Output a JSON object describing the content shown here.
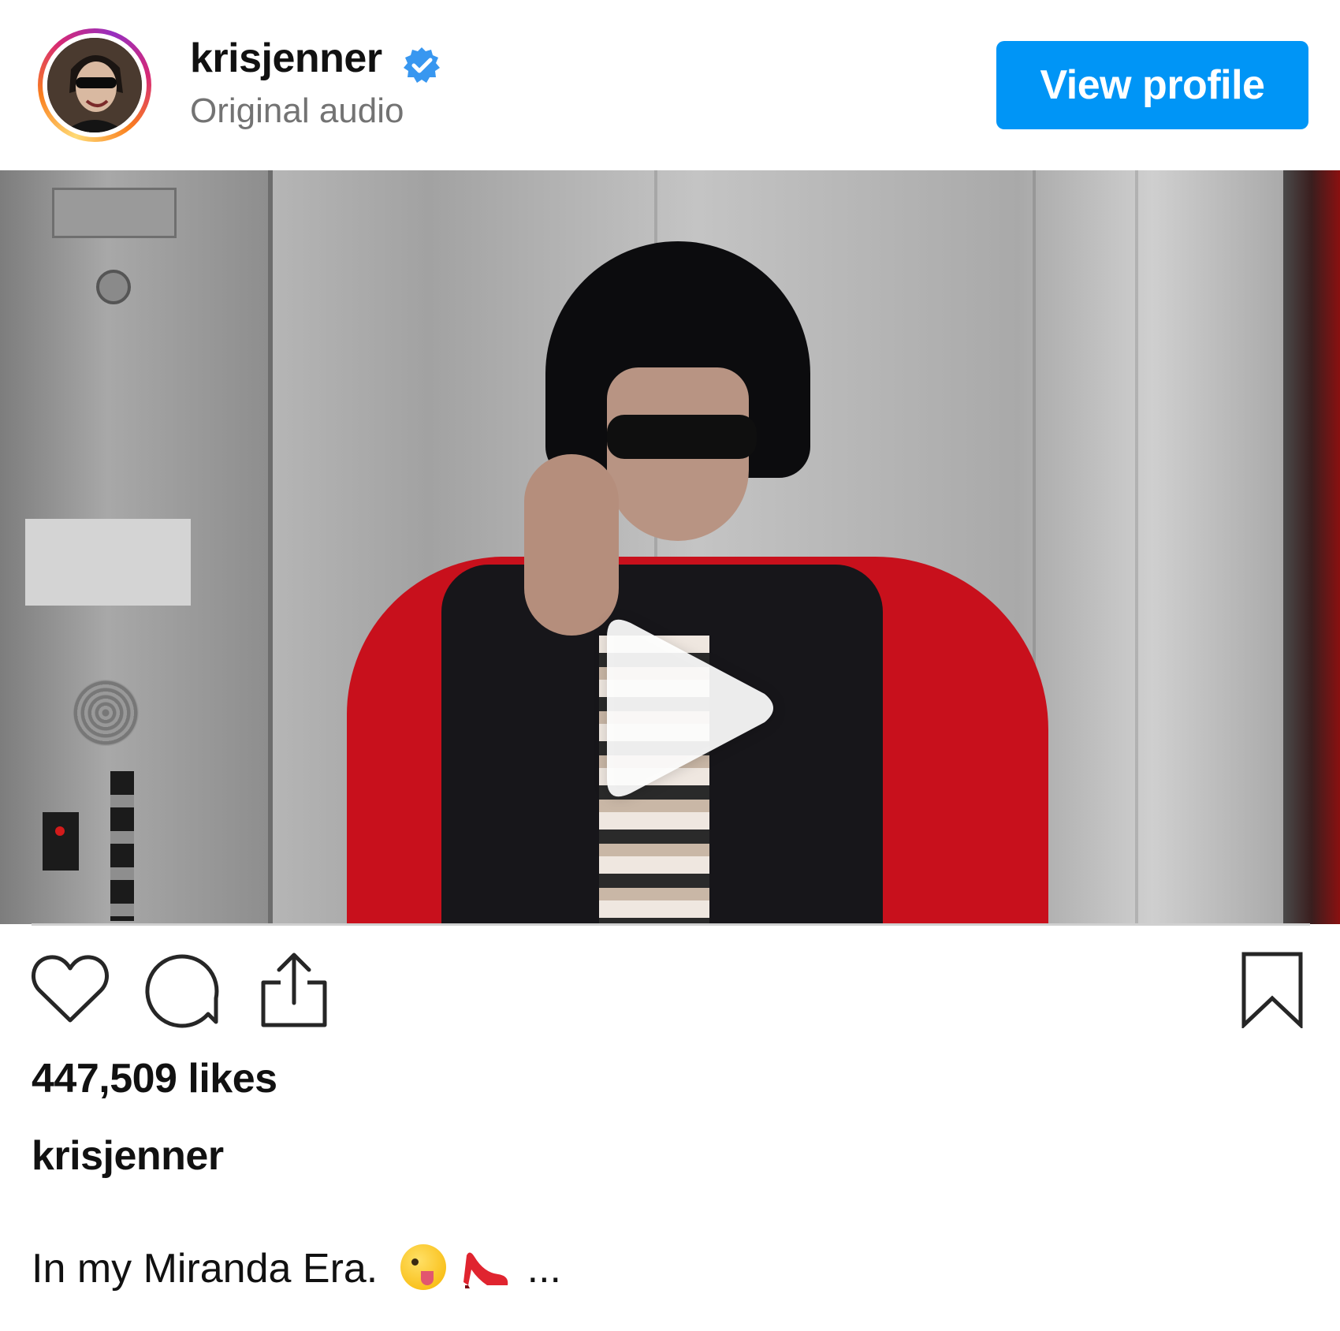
{
  "header": {
    "username": "krisjenner",
    "verified": true,
    "subtitle": "Original audio",
    "view_profile_label": "View profile"
  },
  "media": {
    "type": "video",
    "play_icon": "play-icon"
  },
  "actions": {
    "like_icon": "heart-icon",
    "comment_icon": "comment-icon",
    "share_icon": "share-icon",
    "save_icon": "bookmark-icon"
  },
  "post": {
    "likes": "447,509 likes",
    "caption_username": "krisjenner",
    "caption_text": "In my Miranda Era.",
    "caption_emojis": [
      "winking-face-with-tongue",
      "high-heel"
    ],
    "caption_more": "..."
  },
  "colors": {
    "accent": "#0095f6",
    "verified_badge": "#3897f0",
    "secondary_text": "#737373",
    "text": "#111111"
  }
}
